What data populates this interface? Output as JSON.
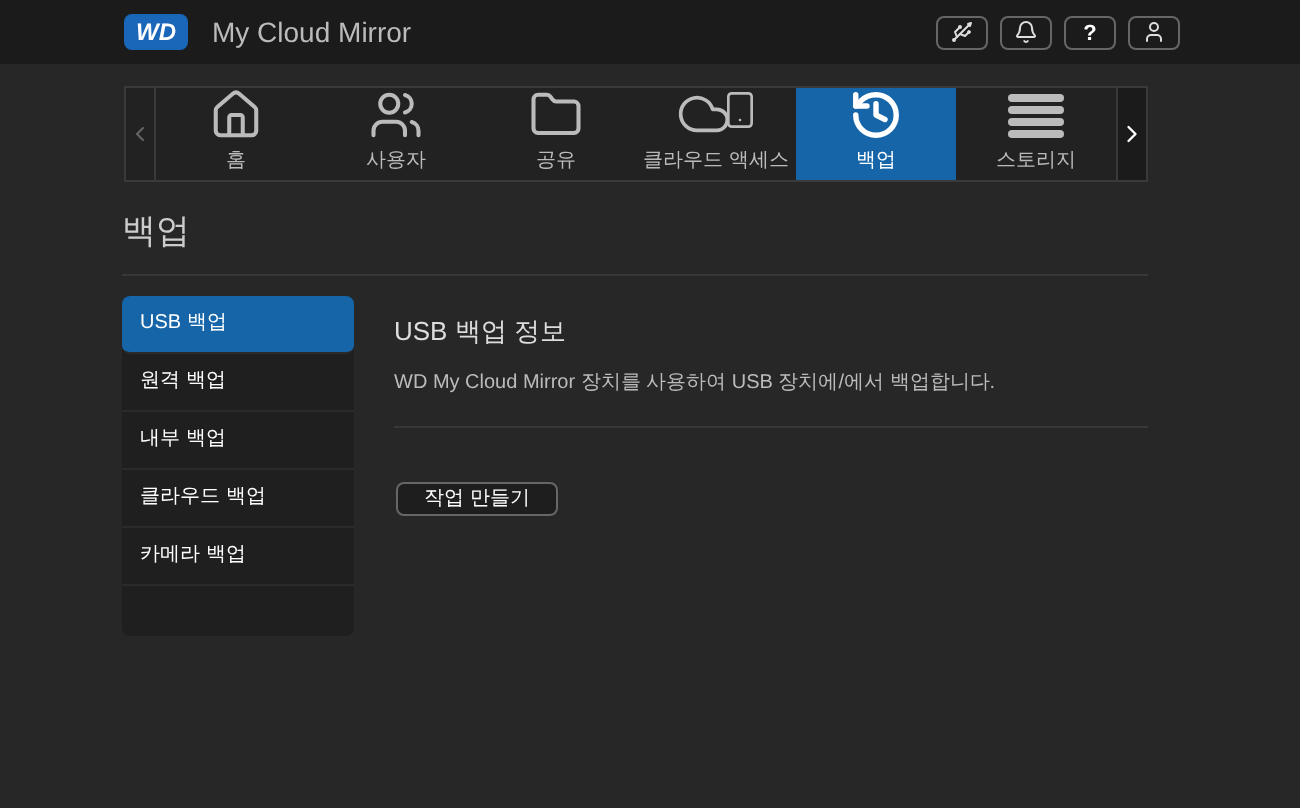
{
  "header": {
    "logo": "WD",
    "product": "My Cloud",
    "product_suffix": "Mirror",
    "help_label": "?"
  },
  "nav": {
    "items": [
      {
        "label": "홈",
        "kind": "home",
        "selected": false
      },
      {
        "label": "사용자",
        "kind": "users",
        "selected": false
      },
      {
        "label": "공유",
        "kind": "shares",
        "selected": false
      },
      {
        "label": "클라우드 액세스",
        "kind": "cloud",
        "selected": false
      },
      {
        "label": "백업",
        "kind": "backup",
        "selected": true
      },
      {
        "label": "스토리지",
        "kind": "storage",
        "selected": false
      }
    ]
  },
  "page_title": "백업",
  "sidebar": {
    "items": [
      {
        "label": "USB 백업",
        "selected": true
      },
      {
        "label": "원격 백업",
        "selected": false
      },
      {
        "label": "내부 백업",
        "selected": false
      },
      {
        "label": "클라우드 백업",
        "selected": false
      },
      {
        "label": "카메라 백업",
        "selected": false
      }
    ]
  },
  "content": {
    "title": "USB 백업 정보",
    "description": "WD My Cloud Mirror 장치를 사용하여 USB 장치에/에서 백업합니다.",
    "button": "작업 만들기"
  }
}
